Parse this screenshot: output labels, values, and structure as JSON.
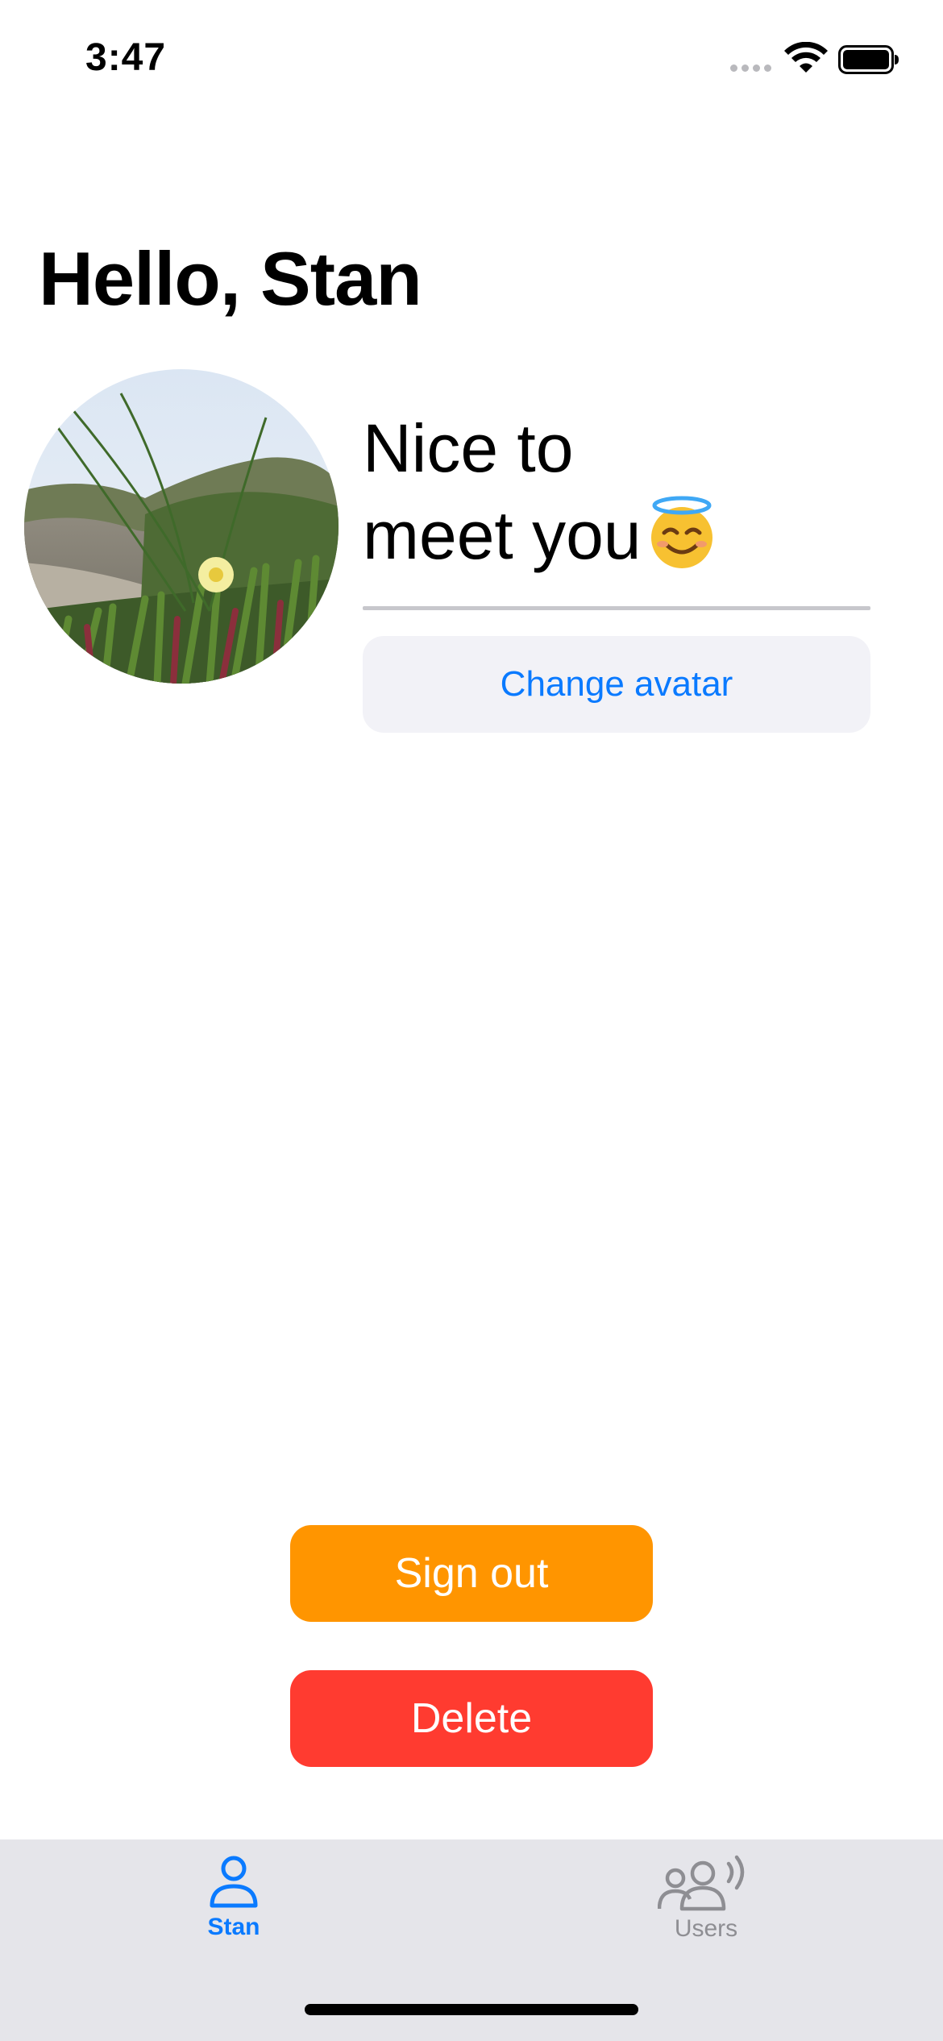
{
  "status_bar": {
    "time": "3:47",
    "icons": [
      "cellular-signal-icon",
      "wifi-icon",
      "battery-icon"
    ]
  },
  "profile": {
    "greeting": "Hello, Stan",
    "welcome_line1": "Nice to",
    "welcome_line2": "meet you",
    "welcome_emoji": "halo-smiling-face-emoji",
    "avatar_image": "beach-grass-flower-photo",
    "change_avatar_label": "Change avatar"
  },
  "actions": {
    "sign_out_label": "Sign out",
    "delete_label": "Delete"
  },
  "tab_bar": {
    "tabs": [
      {
        "label": "Stan",
        "icon": "person-icon",
        "selected": true
      },
      {
        "label": "Users",
        "icon": "users-broadcast-icon",
        "selected": false
      }
    ]
  },
  "colors": {
    "accent": "#0a7aff",
    "sign_out": "#ff9500",
    "delete": "#ff3b30",
    "button_bg": "#f2f2f7",
    "tab_bar_bg": "#e5e5ea",
    "divider": "#c7c7cc",
    "inactive_tab": "#8e8e93"
  }
}
